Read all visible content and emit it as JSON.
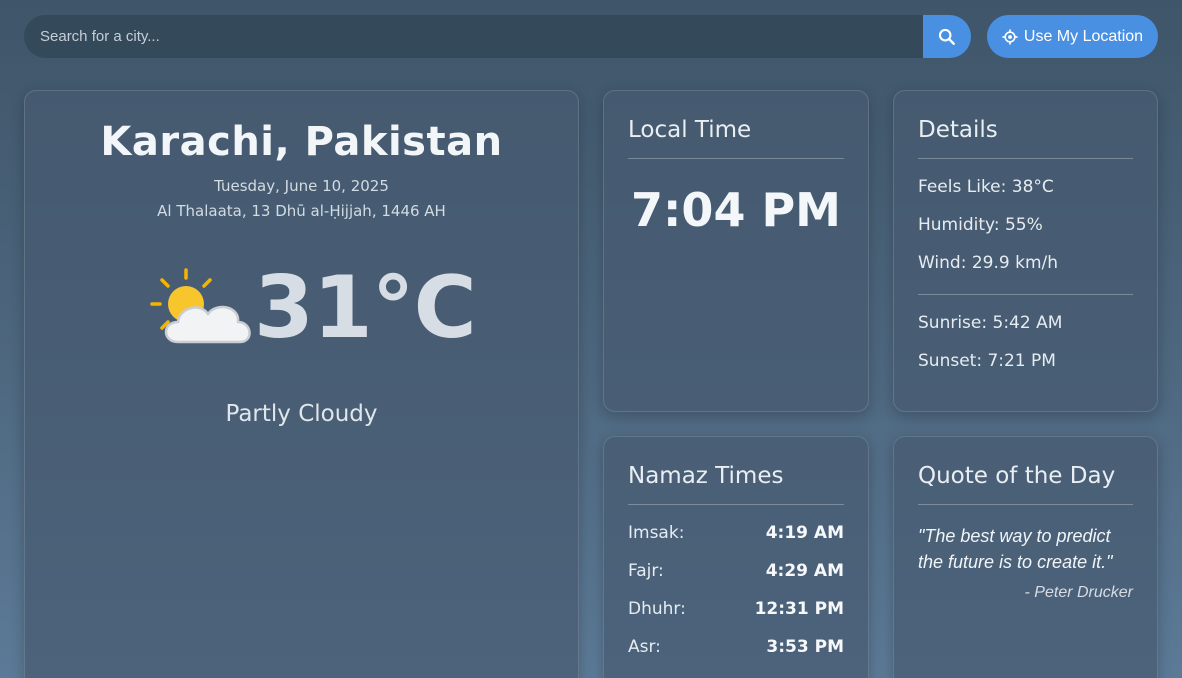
{
  "search": {
    "placeholder": "Search for a city...",
    "search_icon": "search-icon",
    "location_label": "Use My Location",
    "location_icon": "crosshair-icon"
  },
  "weather": {
    "city": "Karachi, Pakistan",
    "date": "Tuesday, June 10, 2025",
    "hijri_date": "Al Thalaata, 13 Dhū al-Ḥijjah, 1446 AH",
    "icon": "partly-cloudy-icon",
    "temperature": "31°C",
    "condition": "Partly Cloudy"
  },
  "local_time": {
    "title": "Local Time",
    "time": "7:04 PM"
  },
  "details": {
    "title": "Details",
    "feels_like": "Feels Like: 38°C",
    "humidity": "Humidity: 55%",
    "wind": "Wind: 29.9 km/h",
    "sunrise": "Sunrise: 5:42 AM",
    "sunset": "Sunset: 7:21 PM"
  },
  "namaz": {
    "title": "Namaz Times",
    "times": [
      {
        "label": "Imsak:",
        "time": "4:19 AM"
      },
      {
        "label": "Fajr:",
        "time": "4:29 AM"
      },
      {
        "label": "Dhuhr:",
        "time": "12:31 PM"
      },
      {
        "label": "Asr:",
        "time": "3:53 PM"
      }
    ]
  },
  "quote": {
    "title": "Quote of the Day",
    "text": "\"The best way to predict the future is to create it.\"",
    "author": "- Peter Drucker"
  },
  "colors": {
    "accent": "#4a90e2",
    "background": "#4e6880",
    "card": "#465a70"
  }
}
